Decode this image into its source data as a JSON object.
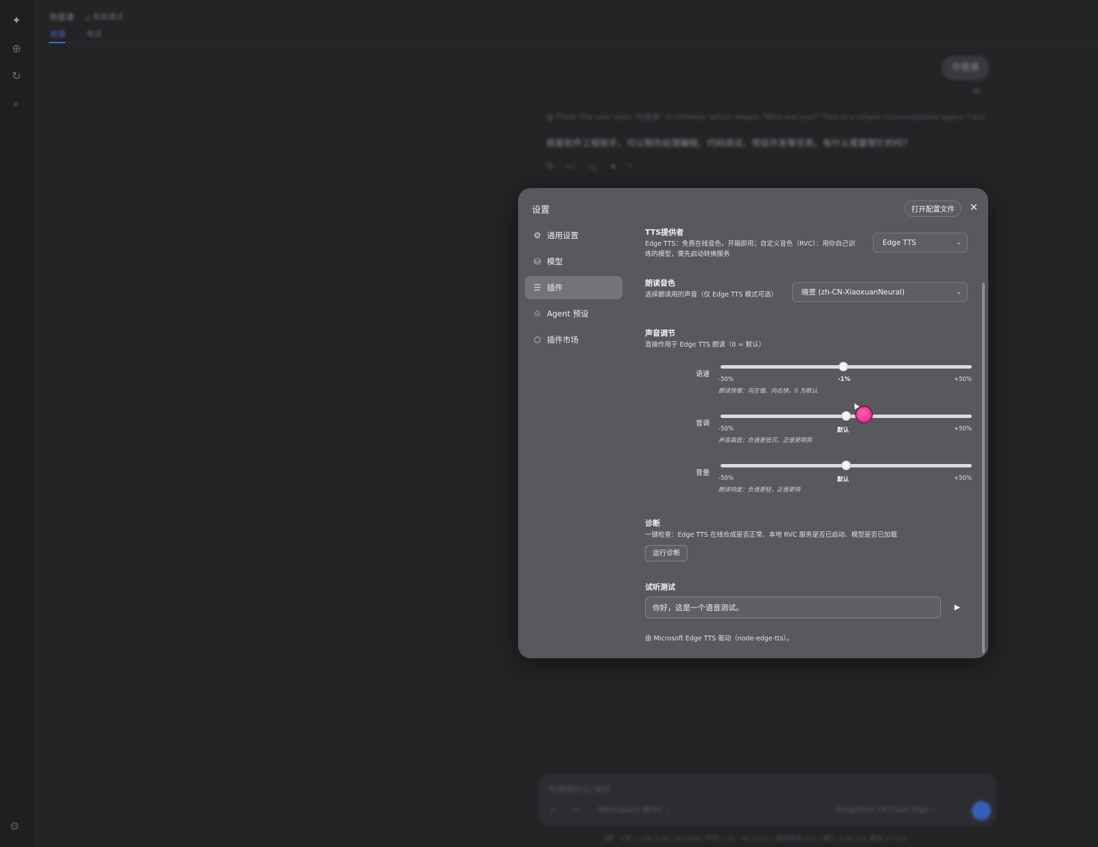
{
  "background": {
    "top_title": "你是谁",
    "top_mode": "△ 智能模式",
    "tabs": [
      {
        "label": "对话"
      },
      {
        "label": "电话"
      }
    ],
    "user_message": "你是谁",
    "think_text": "▤ Think   The user asks \"你是谁\" in Chinese, which means \"Who are you?\" This is a simple conversational query. I sho...",
    "assistant_reply": "我是软件工程助手，可以帮你处理编程、代码调试、项目开发等任务。有什么需要帮忙的吗？",
    "composer_placeholder": "你想做什么?询问",
    "composer_workspace": "Workspace Write ⌄",
    "composer_model": "DeepSeek V4 Flash  High ⌄",
    "status_line": "1轮 · 1步  |  LLM 2.2s  |  ⊞ token 平均 1.3s · 61 tok/s  |  缓存命中 0%  |  输入 1.5K tok  输出 17 tok"
  },
  "settings": {
    "title": "设置",
    "open_config": "打开配置文件",
    "nav": [
      {
        "label": "通用设置",
        "icon": "gear-icon"
      },
      {
        "label": "模型",
        "icon": "database-icon"
      },
      {
        "label": "插件",
        "icon": "sliders-icon",
        "active": true
      },
      {
        "label": "Agent 预设",
        "icon": "agent-icon"
      },
      {
        "label": "插件市场",
        "icon": "store-icon"
      }
    ],
    "tts": {
      "title": "TTS提供者",
      "desc": "Edge TTS：免费在线音色，开箱即用；自定义音色（RVC）：用你自己训练的模型，需先启动转换服务",
      "provider": "Edge TTS"
    },
    "voice": {
      "title": "朗读音色",
      "desc": "选择朗读用的声音（仅 Edge TTS 模式可选）",
      "selected": "晓萱 (zh-CN-XiaoxuanNeural)"
    },
    "adjust": {
      "title": "声音调节",
      "desc": "直接作用于 Edge TTS 朗读（0 = 默认）",
      "min_label": "-50%",
      "max_label": "+50%",
      "sliders": [
        {
          "label": "语速",
          "value_label": "-1%",
          "value": -1,
          "hint": "朗读快慢：向左慢、向右快，0 为默认"
        },
        {
          "label": "音调",
          "value_label": "默认",
          "value": 0,
          "hint": "声音高低：负值更低沉，正值更明亮"
        },
        {
          "label": "音量",
          "value_label": "默认",
          "value": 0,
          "hint": "朗读响度：负值更轻，正值更响"
        }
      ]
    },
    "diagnose": {
      "title": "诊断",
      "desc": "一键检查：Edge TTS 在线合成是否正常、本地 RVC 服务是否已启动、模型是否已加载",
      "button": "运行诊断"
    },
    "test": {
      "title": "试听测试",
      "input_value": "你好，这是一个语音测试。"
    },
    "footer": "由 Microsoft Edge TTS 驱动（node-edge-tts）。"
  }
}
